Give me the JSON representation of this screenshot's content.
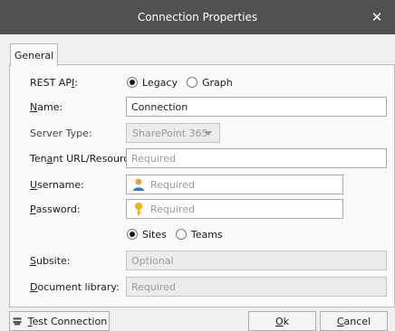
{
  "window": {
    "title": "Connection Properties"
  },
  "tabs": [
    {
      "label": "General"
    }
  ],
  "form": {
    "rest_api": {
      "label": "REST API:",
      "label_pre": "REST AP",
      "label_u": "I",
      "label_post": ":",
      "options": [
        "Legacy",
        "Graph"
      ],
      "selected": "Legacy"
    },
    "name": {
      "label": "Name:",
      "label_u": "N",
      "label_rest": "ame:",
      "value": "Connection"
    },
    "server_type": {
      "label": "Server Type:",
      "value": "SharePoint 365"
    },
    "tenant": {
      "label": "Tenant URL/Resource:",
      "label_pre": "Ten",
      "label_u": "a",
      "label_post": "nt URL/Resource:",
      "placeholder": "Required"
    },
    "username": {
      "label": "Username:",
      "label_u": "U",
      "label_rest": "sername:",
      "placeholder": "Required",
      "icon": "user-icon"
    },
    "password": {
      "label": "Password:",
      "label_u": "P",
      "label_rest": "assword:",
      "placeholder": "Required",
      "icon": "key-icon"
    },
    "scope": {
      "options": [
        "Sites",
        "Teams"
      ],
      "selected": "Sites"
    },
    "subsite": {
      "label": "Subsite:",
      "label_pre": "",
      "label_u": "S",
      "label_rest": "ubsite:",
      "placeholder": "Optional"
    },
    "doc_library": {
      "label": "Document library:",
      "label_u": "D",
      "label_rest": "ocument library:",
      "placeholder": "Required"
    }
  },
  "buttons": {
    "test": {
      "label": "Test Connection",
      "label_u": "T",
      "label_rest": "est Connection",
      "icon": "connection-icon"
    },
    "ok": {
      "label": "Ok",
      "label_u": "O",
      "label_rest": "k"
    },
    "cancel": {
      "label": "Cancel",
      "label_u": "C",
      "label_rest": "ancel"
    }
  },
  "colors": {
    "titlebar": "#505050",
    "user_icon": "#e8a23b",
    "key_icon": "#f0b400"
  }
}
